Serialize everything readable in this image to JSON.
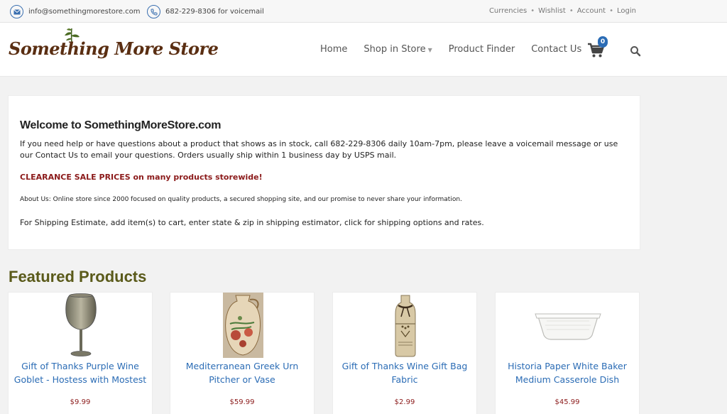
{
  "topbar": {
    "email": "info@somethingmorestore.com",
    "phone": "682-229-8306 for voicemail",
    "links": [
      "Currencies",
      "Wishlist",
      "Account",
      "Login"
    ]
  },
  "header": {
    "logo_text": "Something More Store",
    "nav": [
      "Home",
      "Shop in Store",
      "Product Finder",
      "Contact Us"
    ],
    "cart_count": "0"
  },
  "welcome": {
    "title": "Welcome to SomethingMoreStore.com",
    "intro": "If you need help or have questions about a product that shows as in stock, call 682-229-8306 daily 10am-7pm, please leave a voicemail message or use our Contact Us to email your questions.  Orders usually ship within 1 business day by USPS mail.",
    "sale": "CLEARANCE SALE PRICES on many products storewide!",
    "about": "About Us: Online store since 2000 focused on quality products, a secured shopping site, and our promise to never share your information.",
    "shipping": "For Shipping Estimate, add item(s) to cart, enter state & zip in shipping estimator, click for shipping options and rates."
  },
  "featured": {
    "title": "Featured Products",
    "products": [
      {
        "name": "Gift of Thanks Purple Wine Goblet - Hostess with Mostest",
        "price": "$9.99"
      },
      {
        "name": "Mediterranean Greek Urn Pitcher or Vase",
        "price": "$59.99"
      },
      {
        "name": "Gift of Thanks Wine Gift Bag Fabric",
        "price": "$2.99"
      },
      {
        "name": "Historia Paper White Baker Medium Casserole Dish",
        "price": "$45.99"
      }
    ]
  },
  "colors": {
    "link_blue": "#2b6cb5",
    "price_red": "#8b1a1a",
    "logo_brown": "#5a2e12",
    "featured_olive": "#5a5a1a"
  }
}
